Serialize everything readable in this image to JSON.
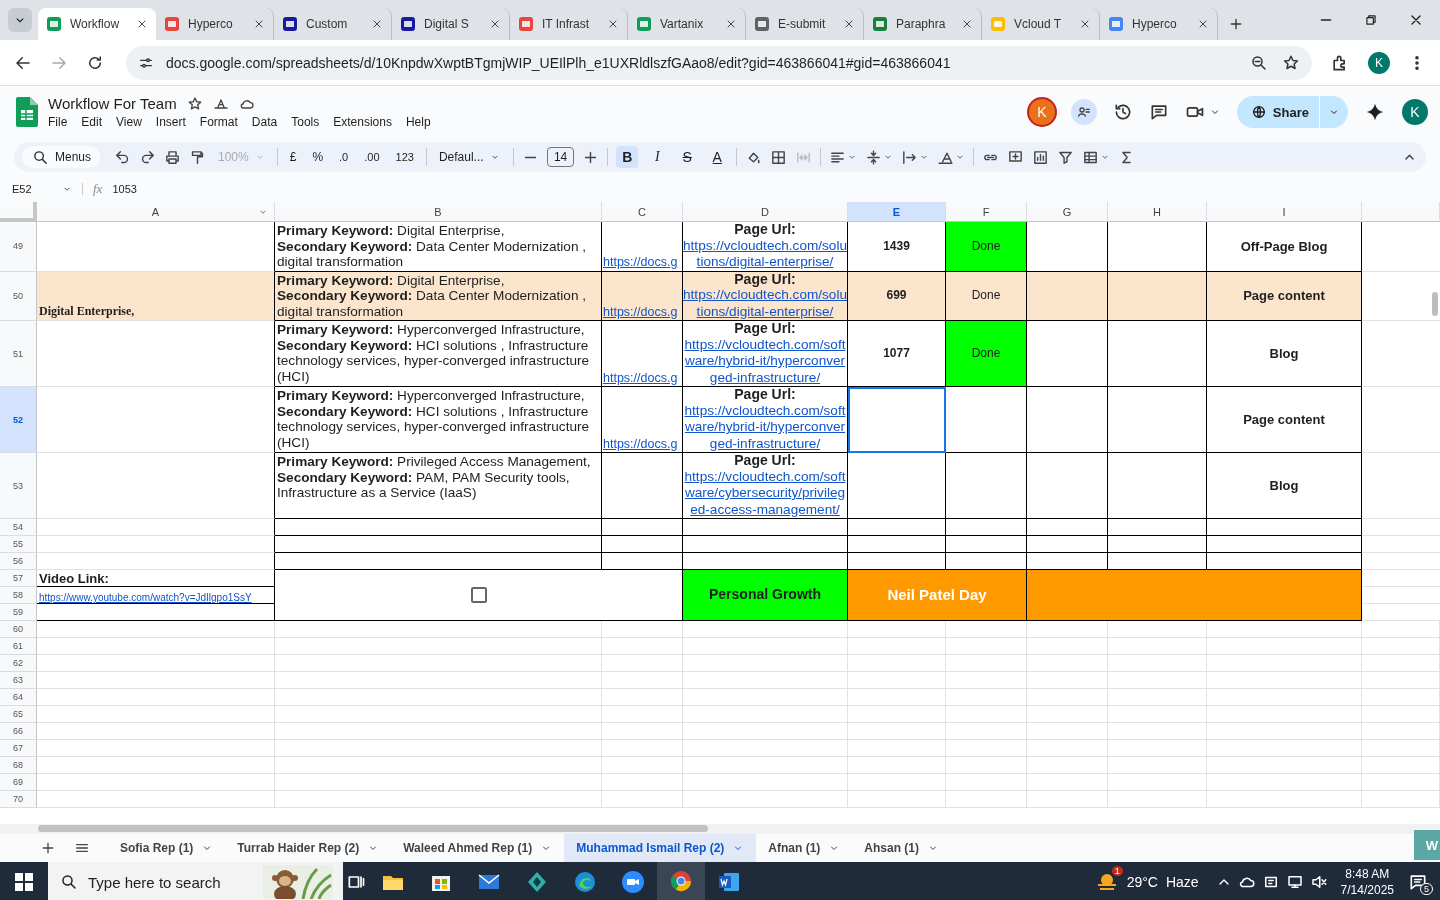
{
  "browser": {
    "tabs": [
      {
        "title": "Workflow",
        "color": "#0f9d58",
        "selected": true
      },
      {
        "title": "Hyperco",
        "color": "#e8453c",
        "selected": false
      },
      {
        "title": "Custom",
        "color": "#1a1a9c",
        "selected": false
      },
      {
        "title": "Digital S",
        "color": "#1a1a9c",
        "selected": false
      },
      {
        "title": "IT Infrast",
        "color": "#e8453c",
        "selected": false
      },
      {
        "title": "Vartanix",
        "color": "#0f9d58",
        "selected": false
      },
      {
        "title": "E-submit",
        "color": "#5f6368",
        "selected": false
      },
      {
        "title": "Paraphra",
        "color": "#188038",
        "selected": false
      },
      {
        "title": "Vcloud T",
        "color": "#fbbc04",
        "selected": false
      },
      {
        "title": "Hyperco",
        "color": "#4285f4",
        "selected": false
      }
    ],
    "url": "docs.google.com/spreadsheets/d/10KnpdwXwptBTgmjWIP_UEIlPlh_e1UXRldlszfGAao8/edit?gid=463866041#gid=463866041",
    "profile": "K"
  },
  "doc": {
    "title": "Workflow For Team",
    "menus": [
      "File",
      "Edit",
      "View",
      "Insert",
      "Format",
      "Data",
      "Tools",
      "Extensions",
      "Help"
    ],
    "collaborator": "K",
    "share": "Share",
    "account": "K"
  },
  "toolbar": {
    "search": "Menus",
    "zoom": "100%",
    "currency": "£",
    "percent": "%",
    "decrease_decimal": ".0",
    "increase_decimal": ".00",
    "number_format": "123",
    "font": "Defaul...",
    "font_size": "14",
    "styles": [
      {
        "label": "B",
        "selected": true
      },
      {
        "label": "I",
        "selected": false
      },
      {
        "label": "S",
        "selected": false
      },
      {
        "label": "A",
        "selected": false
      }
    ]
  },
  "formula_bar": {
    "cell": "E52",
    "fx": "fx",
    "value": "1053"
  },
  "sheet": {
    "columns": [
      {
        "label": "A",
        "selected": false
      },
      {
        "label": "B",
        "selected": false
      },
      {
        "label": "C",
        "selected": false
      },
      {
        "label": "D",
        "selected": false
      },
      {
        "label": "E",
        "selected": true
      },
      {
        "label": "F",
        "selected": false
      },
      {
        "label": "G",
        "selected": false
      },
      {
        "label": "H",
        "selected": false
      },
      {
        "label": "I",
        "selected": false
      }
    ],
    "rows": [
      {
        "number": "49",
        "selected": false,
        "highlighted": false,
        "b": "**Primary Keyword:** Digital Enterprise,\n**Secondary Keyword:** Data Center Modernization , digital transformation",
        "c": "https://docs.g",
        "d_label": "Page Url:",
        "d_link": "https://vcloudtech.com/solutions/digital-enterprise/",
        "e": "1439",
        "status": {
          "text": "Done",
          "color": "#00ff00"
        },
        "i": "Off-Page Blog"
      },
      {
        "number": "50",
        "selected": false,
        "highlighted": true,
        "a": "Digital Enterprise,",
        "b": "**Primary Keyword:** Digital Enterprise,\n**Secondary Keyword:** Data Center Modernization , digital transformation",
        "c": "https://docs.g",
        "d_label": "Page Url:",
        "d_link": "https://vcloudtech.com/solutions/digital-enterprise/",
        "e": "699",
        "status": {
          "text": "Done"
        },
        "i": "Page content"
      },
      {
        "number": "51",
        "selected": false,
        "highlighted": false,
        "b": "**Primary Keyword:** Hyperconverged Infrastructure,\n**Secondary Keyword:** HCI solutions , Infrastructure technology services, hyper-converged infrastructure (HCI)",
        "c": "https://docs.g",
        "d_label": "Page Url:",
        "d_link": "https://vcloudtech.com/software/hybrid-it/hyperconverged-infrastructure/",
        "e": "1077",
        "status": {
          "text": "Done",
          "color": "#00ff00"
        },
        "i": "Blog"
      },
      {
        "number": "52",
        "selected": true,
        "highlighted": false,
        "b": "**Primary Keyword:** Hyperconverged Infrastructure,\n**Secondary Keyword:** HCI solutions , Infrastructure technology services, hyper-converged infrastructure (HCI)",
        "c": "https://docs.g",
        "d_label": "Page Url:",
        "d_link": "https://vcloudtech.com/software/hybrid-it/hyperconverged-infrastructure/",
        "i": "Page content"
      },
      {
        "number": "53",
        "selected": false,
        "highlighted": false,
        "b": "**Primary Keyword:** Privileged Access Management,\n**Secondary Keyword:** PAM, PAM Security tools, Infrastructure as a Service (IaaS)",
        "d_label": "Page Url:",
        "d_link": "https://vcloudtech.com/software/cybersecurity/privileged-access-management/",
        "i": "Blog"
      }
    ],
    "empty_rows": [
      "54",
      "55",
      "56"
    ],
    "block": {
      "numbers": [
        "57",
        "58",
        "59"
      ],
      "video_label": "Video Link:",
      "video_link": "https://www.youtube.com/watch?v=JdIlgpo1SsY",
      "checked": false,
      "growth": {
        "text": "Personal Growth",
        "color": "#00ff00"
      },
      "day": {
        "text": "Neil Patel Day",
        "color": "#ff9900"
      },
      "fill": {
        "color": "#ff9900"
      }
    },
    "blank_rows": [
      "60",
      "61",
      "62",
      "63",
      "64",
      "65",
      "66",
      "67",
      "68",
      "69",
      "70"
    ]
  },
  "sheet_tabs": [
    {
      "label": "Sofia Rep (1)",
      "selected": false
    },
    {
      "label": "Turrab Haider Rep (2)",
      "selected": false
    },
    {
      "label": "Waleed Ahmed Rep (1)",
      "selected": false
    },
    {
      "label": "Muhammad Ismail Rep (2)",
      "selected": true
    },
    {
      "label": "Afnan (1)",
      "selected": false
    },
    {
      "label": "Ahsan (1)",
      "selected": false
    }
  ],
  "corner_badge": "W",
  "taskbar": {
    "search": "Type here to search",
    "weather_badge": "1",
    "temperature": "29°C",
    "condition": "Haze",
    "time": "8:48 AM",
    "date": "7/14/2025",
    "notifications": "5"
  }
}
